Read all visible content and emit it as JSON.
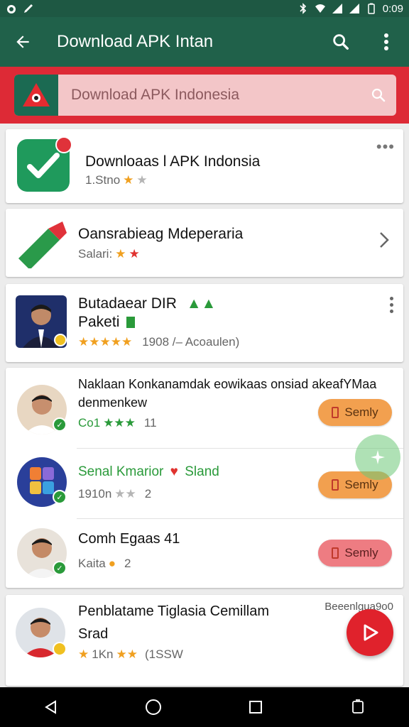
{
  "status_bar": {
    "time": "0:09"
  },
  "app_bar": {
    "title": "Download APK Intan"
  },
  "search": {
    "placeholder": "Download APK Indonesia"
  },
  "cards": {
    "c1": {
      "title": "Downloaas l APK Indonsia",
      "sub": "1.Stno"
    },
    "c2": {
      "title": "Oansrabieag Mdeperaria",
      "sub": "Salari:"
    },
    "c3": {
      "title_line1": "Butadaear DIR",
      "title_line2": "Paketi",
      "rating": "1908 /– Acoaulen)"
    },
    "c4": {
      "header": "Naklaan Konkanamdak eowikaas onsiad akeafYMaa denmenkew",
      "item1": {
        "rating_text": "Co1",
        "count": "11",
        "button": "Semly"
      },
      "item2": {
        "name": "Senal Kmarior",
        "name_suffix": "Sland",
        "rating_text": "1910n",
        "count": "2",
        "button": "Semly"
      },
      "item3": {
        "name": "Comh Egaas 41",
        "rating_text": "Kaita",
        "count": "2",
        "button": "Semly"
      }
    },
    "c5": {
      "title_line1": "Penblatame Tiglasia Cemillam",
      "title_line2": "Srad",
      "corner_text": "Beeenlgua9o0",
      "rating_text": "1Kn",
      "count": "(1SSW"
    }
  },
  "colors": {
    "app_bar": "#20614a",
    "banner": "#dd2a36",
    "fab": "#e0222c",
    "button_orange": "#f2a04f",
    "button_red": "#ee7c82"
  },
  "icons": [
    "back-arrow-icon",
    "search-icon",
    "more-vert-icon",
    "play-icon",
    "home-icon",
    "recents-icon"
  ]
}
